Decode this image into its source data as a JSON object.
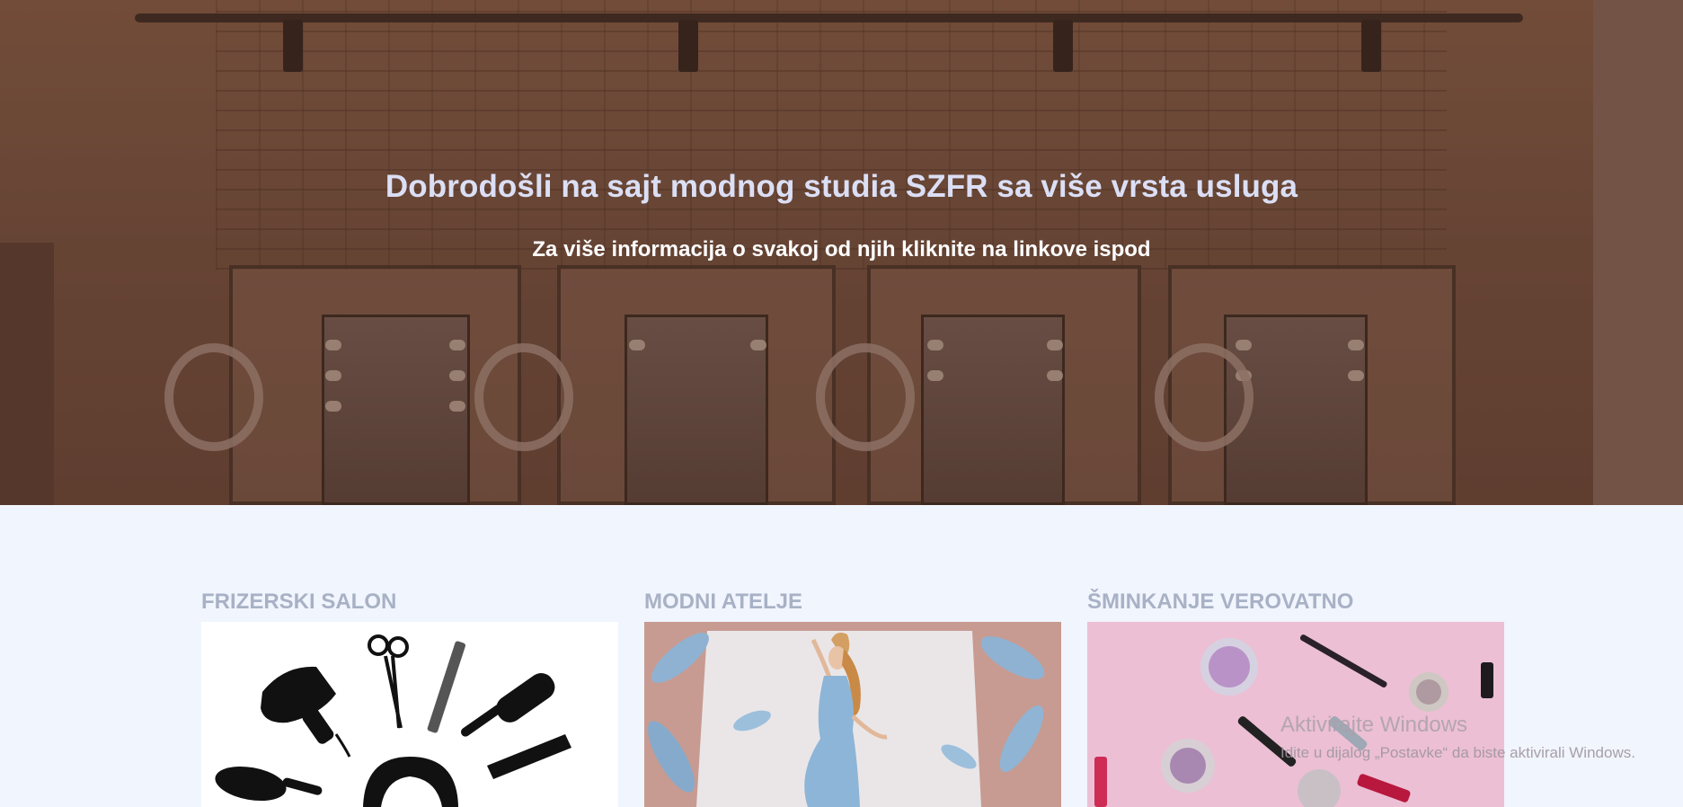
{
  "hero": {
    "title": "Dobrodošli na sajt modnog studia SZFR sa više vrsta usluga",
    "subtitle": "Za više informacija o svakoj od njih kliknite na linkove ispod"
  },
  "cards": [
    {
      "title": "FRIZERSKI SALON"
    },
    {
      "title": "MODNI ATELJE"
    },
    {
      "title": "ŠMINKANJE VEROVATNO"
    }
  ],
  "watermark": {
    "title": "Aktivirajte Windows",
    "text": "Idite u dijalog „Postavke“ da biste aktivirali Windows."
  },
  "colors": {
    "page_bg": "#f1f5fd",
    "hero_title": "#dbdff5",
    "card_title": "#a8b1c5"
  }
}
